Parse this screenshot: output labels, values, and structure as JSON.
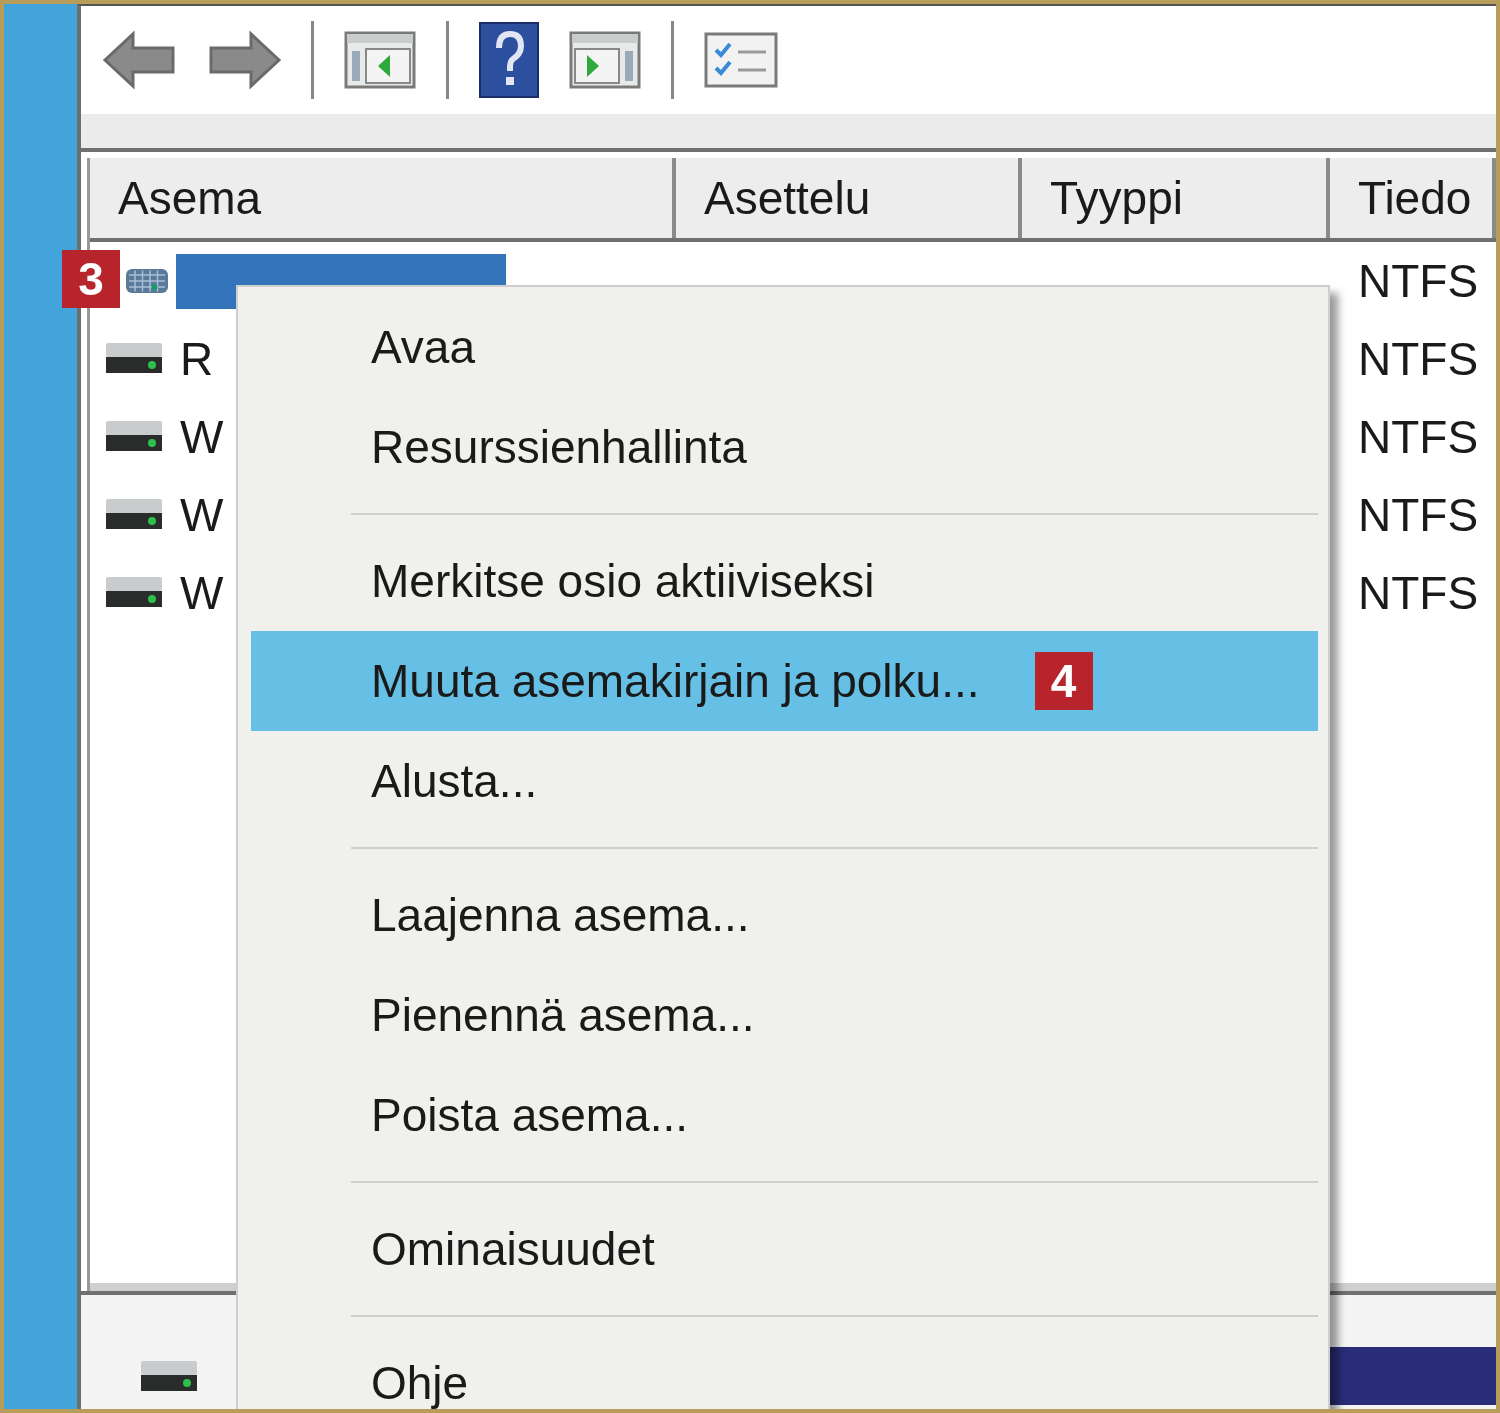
{
  "toolbar": {
    "buttons": [
      {
        "kind": "back"
      },
      {
        "kind": "forward"
      },
      {
        "kind": "separator"
      },
      {
        "kind": "tree"
      },
      {
        "kind": "separator"
      },
      {
        "kind": "help"
      },
      {
        "kind": "pane"
      },
      {
        "kind": "separator"
      },
      {
        "kind": "props"
      }
    ]
  },
  "table": {
    "columns": [
      "Asema",
      "Asettelu",
      "Tyyppi",
      "Tiedo"
    ],
    "rows": [
      {
        "kind": "usb",
        "selected": true,
        "fs": "NTFS",
        "callout": "3"
      },
      {
        "kind": "disk",
        "name": "R",
        "selected": false,
        "fs": "NTFS"
      },
      {
        "kind": "disk",
        "name": "W",
        "selected": false,
        "fs": "NTFS"
      },
      {
        "kind": "disk",
        "name": "W",
        "selected": false,
        "fs": "NTFS"
      },
      {
        "kind": "disk",
        "name": "W",
        "selected": false,
        "fs": "NTFS"
      }
    ]
  },
  "context_menu": {
    "items": [
      {
        "kind": "item",
        "label": "Avaa",
        "selected": false
      },
      {
        "kind": "item",
        "label": "Resurssienhallinta",
        "selected": false
      },
      {
        "kind": "separator"
      },
      {
        "kind": "item",
        "label": "Merkitse osio aktiiviseksi",
        "selected": false
      },
      {
        "kind": "item",
        "label": "Muuta asemakirjain ja polku...",
        "selected": true,
        "callout": "4"
      },
      {
        "kind": "item",
        "label": "Alusta...",
        "selected": false
      },
      {
        "kind": "separator"
      },
      {
        "kind": "item",
        "label": "Laajenna asema...",
        "selected": false
      },
      {
        "kind": "item",
        "label": "Pienennä asema...",
        "selected": false
      },
      {
        "kind": "item",
        "label": "Poista asema...",
        "selected": false
      },
      {
        "kind": "separator"
      },
      {
        "kind": "item",
        "label": "Ominaisuudet",
        "selected": false
      },
      {
        "kind": "separator"
      },
      {
        "kind": "item",
        "label": "Ohje",
        "selected": false
      }
    ]
  }
}
